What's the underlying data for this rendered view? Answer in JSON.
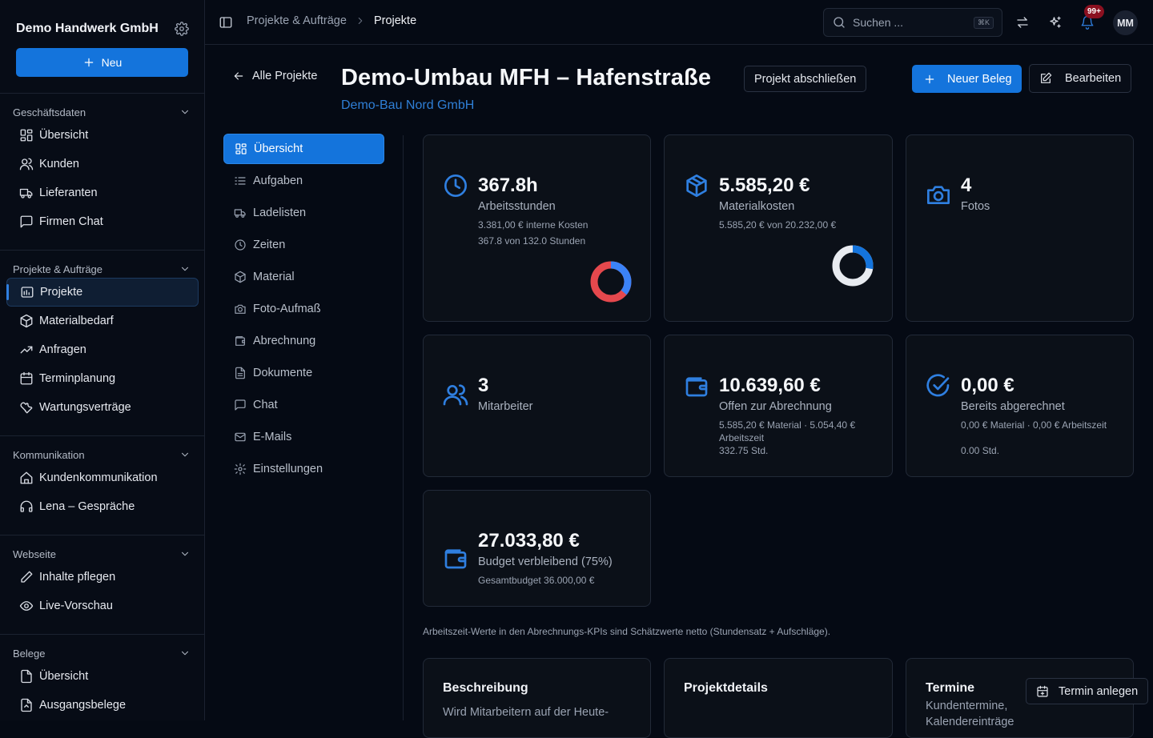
{
  "sidebar": {
    "company": "Demo Handwerk GmbH",
    "new_label": "Neu",
    "sections": [
      {
        "title": "Geschäftsdaten",
        "items": [
          {
            "label": "Übersicht",
            "icon": "dashboard-icon"
          },
          {
            "label": "Kunden",
            "icon": "user-icon"
          },
          {
            "label": "Lieferanten",
            "icon": "truck-icon"
          },
          {
            "label": "Firmen Chat",
            "icon": "chat-icon"
          }
        ]
      },
      {
        "title": "Projekte & Aufträge",
        "items": [
          {
            "label": "Projekte",
            "icon": "project-icon",
            "active": true
          },
          {
            "label": "Materialbedarf",
            "icon": "box-icon"
          },
          {
            "label": "Anfragen",
            "icon": "trend-icon"
          },
          {
            "label": "Terminplanung",
            "icon": "calendar-icon"
          },
          {
            "label": "Wartungsverträge",
            "icon": "wrench-icon"
          }
        ]
      },
      {
        "title": "Kommunikation",
        "items": [
          {
            "label": "Kundenkommunikation",
            "icon": "home-icon"
          },
          {
            "label": "Lena – Gespräche",
            "icon": "headset-icon"
          }
        ]
      },
      {
        "title": "Webseite",
        "items": [
          {
            "label": "Inhalte pflegen",
            "icon": "pen-icon"
          },
          {
            "label": "Live-Vorschau",
            "icon": "eye-icon"
          }
        ]
      },
      {
        "title": "Belege",
        "items": [
          {
            "label": "Übersicht",
            "icon": "file-icon"
          },
          {
            "label": "Ausgangsbelege",
            "icon": "file-out-icon"
          }
        ]
      }
    ]
  },
  "topbar": {
    "crumb_parent": "Projekte & Aufträge",
    "crumb_current": "Projekte",
    "search_placeholder": "Suchen ...",
    "search_shortcut": "⌘K",
    "notification_count": "99+",
    "avatar_initials": "MM"
  },
  "project": {
    "back_label": "Alle Projekte",
    "title": "Demo-Umbau MFH – Hafenstraße",
    "client": "Demo-Bau Nord GmbH",
    "close_label": "Projekt abschließen",
    "new_doc_label": "Neuer Beleg",
    "edit_label": "Bearbeiten"
  },
  "subnav": [
    {
      "label": "Übersicht",
      "icon": "dashboard-icon",
      "active": true
    },
    {
      "label": "Aufgaben",
      "icon": "list-icon"
    },
    {
      "label": "Ladelisten",
      "icon": "truck-icon"
    },
    {
      "label": "Zeiten",
      "icon": "clock-icon"
    },
    {
      "label": "Material",
      "icon": "box-icon"
    },
    {
      "label": "Foto-Aufmaß",
      "icon": "camera-icon"
    },
    {
      "label": "Abrechnung",
      "icon": "wallet-icon"
    },
    {
      "label": "Dokumente",
      "icon": "file-icon"
    },
    {
      "label": "Chat",
      "icon": "chat-icon"
    },
    {
      "label": "E-Mails",
      "icon": "mail-icon"
    },
    {
      "label": "Einstellungen",
      "icon": "gear-icon"
    }
  ],
  "kpis": {
    "hours": {
      "value": "367.8h",
      "label": "Arbeitsstunden",
      "sub1": "3.381,00 € interne Kosten",
      "sub2": "367.8 von 132.0 Stunden",
      "donut_fraction": 1.0,
      "donut_over": true
    },
    "material": {
      "value": "5.585,20 €",
      "label": "Materialkosten",
      "sub1": "5.585,20 € von 20.232,00 €",
      "donut_fraction": 0.276
    },
    "photos": {
      "value": "4",
      "label": "Fotos"
    },
    "staff": {
      "value": "3",
      "label": "Mitarbeiter"
    },
    "open": {
      "value": "10.639,60 €",
      "label": "Offen zur Abrechnung",
      "sub": "5.585,20 € Material · 5.054,40 € Arbeitszeit",
      "sub2": "332.75 Std."
    },
    "billed": {
      "value": "0,00 €",
      "label": "Bereits abgerechnet",
      "sub": "0,00 € Material · 0,00 € Arbeitszeit",
      "sub2": "0.00 Std."
    },
    "budget": {
      "value": "27.033,80 €",
      "label": "Budget verbleibend (75%)",
      "sub": "Gesamtbudget 36.000,00 €"
    }
  },
  "note": "Arbeitszeit-Werte in den Abrechnungs-KPIs sind Schätzwerte netto (Stundensatz + Aufschläge).",
  "sections": {
    "description": {
      "title": "Beschreibung",
      "text": "Wird Mitarbeitern auf der Heute-"
    },
    "details": {
      "title": "Projektdetails"
    },
    "appointments": {
      "title": "Termine",
      "text": "Kundentermine, Kalendereinträge"
    }
  },
  "float_button": "Termin anlegen",
  "colors": {
    "accent": "#1474dc",
    "danger": "#e5484d",
    "donut_track": "#e8ebf0",
    "badge": "#8b1020"
  }
}
